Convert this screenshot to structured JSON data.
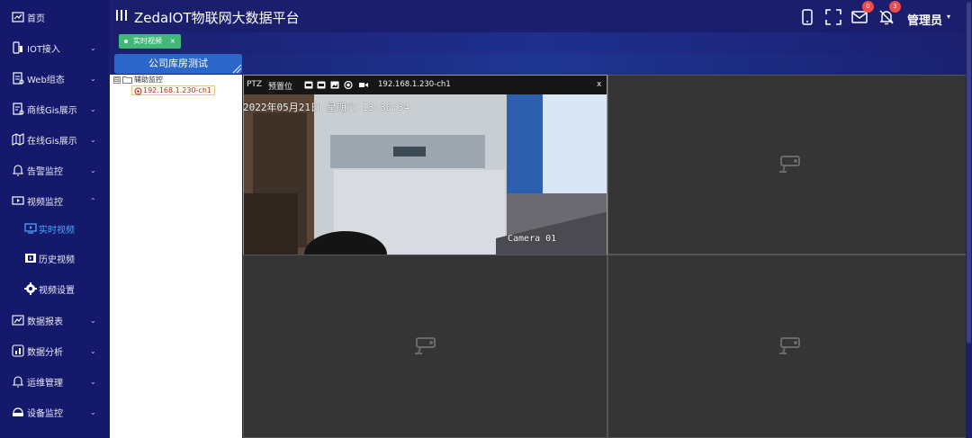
{
  "header": {
    "title": "ZedaIOT物联网大数据平台",
    "mail_badge": "0",
    "bell_badge": "3",
    "user_name": "管理员"
  },
  "sidebar": {
    "items": [
      {
        "label": "首页",
        "icon": "dashboard-icon"
      },
      {
        "label": "IOT接入",
        "icon": "device-icon",
        "chevron": "⌄"
      },
      {
        "label": "Web组态",
        "icon": "doc-icon",
        "chevron": "⌄"
      },
      {
        "label": "商线Gis展示",
        "icon": "map-doc-icon",
        "chevron": "⌄"
      },
      {
        "label": "在线Gis展示",
        "icon": "map-icon",
        "chevron": "⌄"
      },
      {
        "label": "告警监控",
        "icon": "bell-icon",
        "chevron": "⌄"
      },
      {
        "label": "视频监控",
        "icon": "video-icon",
        "chevron": "⌃"
      },
      {
        "label": "实时视频",
        "icon": "monitor-icon"
      },
      {
        "label": "历史视频",
        "icon": "film-icon"
      },
      {
        "label": "视频设置",
        "icon": "gear-icon"
      },
      {
        "label": "数据报表",
        "icon": "chart-icon",
        "chevron": "⌄"
      },
      {
        "label": "数据分析",
        "icon": "analysis-icon",
        "chevron": "⌄"
      },
      {
        "label": "运维管理",
        "icon": "bell-outline-icon",
        "chevron": "⌄"
      },
      {
        "label": "设备监控",
        "icon": "router-icon",
        "chevron": "⌄"
      }
    ]
  },
  "tabs": [
    {
      "label": "实时视频",
      "close": "×"
    }
  ],
  "group_button": "公司库房测试",
  "tree": {
    "root": "辅助监控",
    "expander": "⊟",
    "child": "192.168.1.230-ch1"
  },
  "video": {
    "ptz_label": "PTZ",
    "preset_label": "预置位",
    "channel": "192.168.1.230-ch1",
    "close": "x",
    "osd_datetime": "2022年05月21日  星期六  13:30:34",
    "osd_camera": "Camera 01"
  },
  "colors": {
    "sidebar_bg": "#15196b",
    "header_bg": "#1a1e6c",
    "active_nav": "#4ea3ff",
    "tab_green": "#3fb878",
    "group_blue": "#2a67c8",
    "badge_red": "#f04a4a"
  }
}
